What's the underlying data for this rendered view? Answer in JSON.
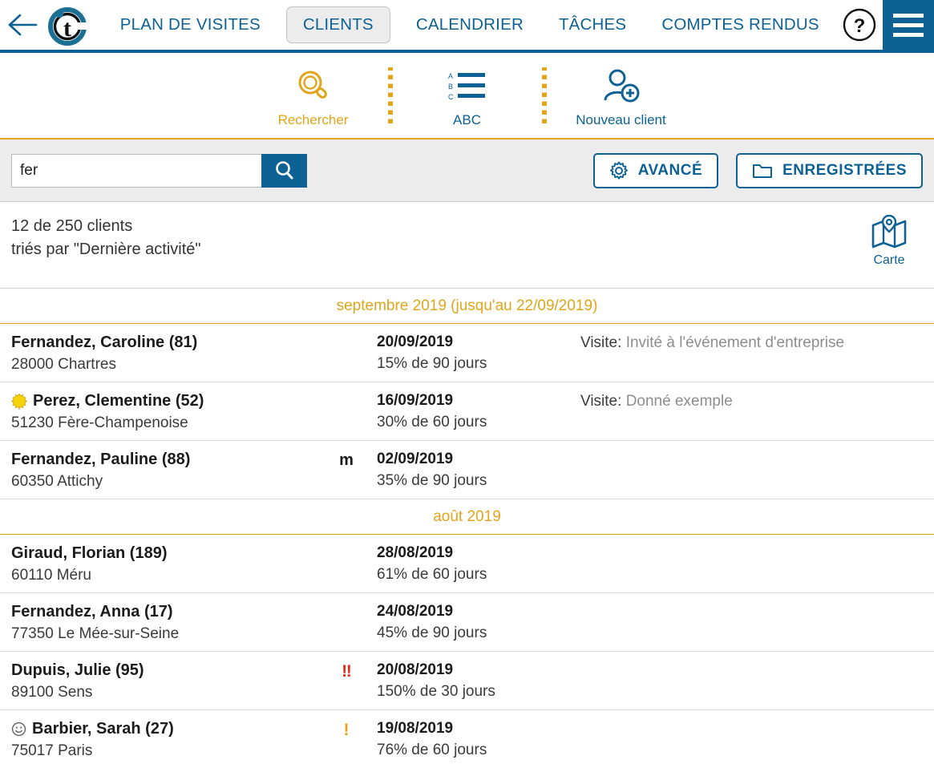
{
  "nav": {
    "back_icon": "back-arrow-icon",
    "logo_icon": "app-logo-t-icon",
    "items": [
      {
        "label": "PLAN DE VISITES",
        "active": false
      },
      {
        "label": "CLIENTS",
        "active": true
      },
      {
        "label": "CALENDRIER",
        "active": false
      },
      {
        "label": "TÂCHES",
        "active": false
      },
      {
        "label": "COMPTES RENDUS",
        "active": false
      }
    ],
    "help_label": "?",
    "menu_icon": "hamburger-menu-icon",
    "accent_blue": "#0d6194"
  },
  "toolbar": {
    "accent_gold": "#e0a51a",
    "tools": [
      {
        "label": "Rechercher",
        "icon": "magnifier-icon",
        "active": true
      },
      {
        "label": "ABC",
        "icon": "abc-list-icon",
        "active": false
      },
      {
        "label": "Nouveau client",
        "icon": "add-user-icon",
        "active": false
      }
    ]
  },
  "search": {
    "value": "fer",
    "placeholder": "",
    "go_icon": "search-icon",
    "advanced_label": "AVANCÉ",
    "advanced_icon": "gear-icon",
    "saved_label": "ENREGISTRÉES",
    "saved_icon": "folder-icon"
  },
  "summary": {
    "count_line": "12 de 250 clients",
    "sort_line": "triés par \"Dernière activité\"",
    "map_label": "Carte",
    "map_icon": "map-icon"
  },
  "list": {
    "groups": [
      {
        "month": "septembre 2019 (jusqu'au 22/09/2019)",
        "rows": [
          {
            "badge": "",
            "name": "Fernandez, Caroline (81)",
            "address": "28000 Chartres",
            "flag": "",
            "flag_type": "",
            "date": "20/09/2019",
            "percent": "15% de 90 jours",
            "visit_label": "Visite:",
            "visit_value": "Invité à l'événement d'entreprise"
          },
          {
            "badge": "sun",
            "name": "Perez, Clementine (52)",
            "address": "51230 Fère-Champenoise",
            "flag": "",
            "flag_type": "",
            "date": "16/09/2019",
            "percent": "30% de 60 jours",
            "visit_label": "Visite:",
            "visit_value": "Donné exemple"
          },
          {
            "badge": "",
            "name": "Fernandez, Pauline (88)",
            "address": "60350 Attichy",
            "flag": "m",
            "flag_type": "m",
            "date": "02/09/2019",
            "percent": "35% de 90 jours",
            "visit_label": "",
            "visit_value": ""
          }
        ]
      },
      {
        "month": "août 2019",
        "rows": [
          {
            "badge": "",
            "name": "Giraud, Florian (189)",
            "address": "60110 Méru",
            "flag": "",
            "flag_type": "",
            "date": "28/08/2019",
            "percent": "61% de 60 jours",
            "visit_label": "",
            "visit_value": ""
          },
          {
            "badge": "",
            "name": "Fernandez, Anna (17)",
            "address": "77350 Le Mée-sur-Seine",
            "flag": "",
            "flag_type": "",
            "date": "24/08/2019",
            "percent": "45% de 90 jours",
            "visit_label": "",
            "visit_value": ""
          },
          {
            "badge": "",
            "name": "Dupuis, Julie (95)",
            "address": "89100 Sens",
            "flag": "‼",
            "flag_type": "red",
            "date": "20/08/2019",
            "percent": "150% de 30 jours",
            "visit_label": "",
            "visit_value": ""
          },
          {
            "badge": "smiley",
            "name": "Barbier, Sarah (27)",
            "address": "75017 Paris",
            "flag": "!",
            "flag_type": "orange",
            "date": "19/08/2019",
            "percent": "76% de 60 jours",
            "visit_label": "",
            "visit_value": ""
          }
        ]
      }
    ]
  }
}
